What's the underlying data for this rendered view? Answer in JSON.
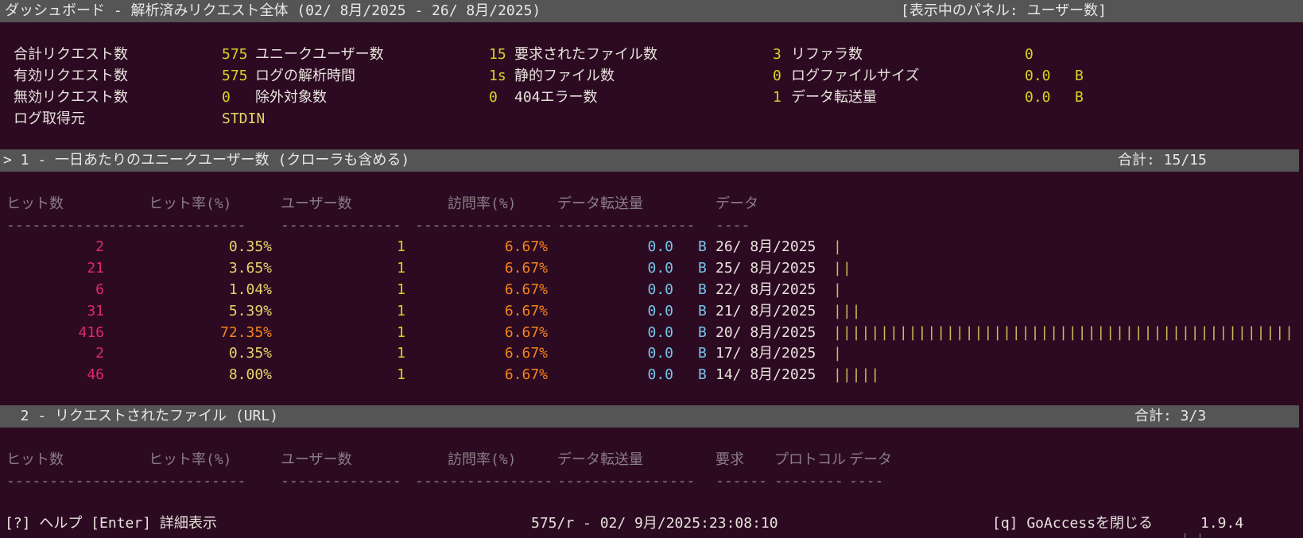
{
  "header": {
    "title": "ダッシュボード - 解析済みリクエスト全体 (02/ 8月/2025 - 26/ 8月/2025)",
    "active_panel": "[表示中のパネル: ユーザー数]"
  },
  "overall": {
    "col1": [
      {
        "label": "合計リクエスト数",
        "value": "575"
      },
      {
        "label": "有効リクエスト数",
        "value": "575"
      },
      {
        "label": "無効リクエスト数",
        "value": "0"
      },
      {
        "label": "ログ取得元",
        "value": "STDIN"
      }
    ],
    "col2": [
      {
        "label": "ユニークユーザー数",
        "value": "15"
      },
      {
        "label": "ログの解析時間",
        "value": "1s"
      },
      {
        "label": "除外対象数",
        "value": "0"
      }
    ],
    "col3": [
      {
        "label": "要求されたファイル数",
        "value": "3"
      },
      {
        "label": "静的ファイル数",
        "value": "0"
      },
      {
        "label": "404エラー数",
        "value": "1"
      }
    ],
    "col4": [
      {
        "label": "リファラ数",
        "value": "0",
        "unit": ""
      },
      {
        "label": "ログファイルサイズ",
        "value": "0.0",
        "unit": "B"
      },
      {
        "label": "データ転送量",
        "value": "0.0",
        "unit": "B"
      }
    ]
  },
  "panel1": {
    "title": "> 1 - 一日あたりのユニークユーザー数 (クローラも含める)",
    "total": "合計: 15/15",
    "columns": [
      "ヒット数",
      "ヒット率(%)",
      "ユーザー数",
      "訪問率(%)",
      "データ転送量",
      "データ"
    ],
    "dashes": [
      "------------",
      "----------------",
      "--------------",
      "----------------",
      "----------------",
      "----"
    ],
    "rows": [
      {
        "hits": "2",
        "hit_pct": "0.35%",
        "visitors": "1",
        "visit_pct": "6.67%",
        "bw": "0.0",
        "unit": "B",
        "date": "26/ 8月/2025",
        "graph": "|"
      },
      {
        "hits": "21",
        "hit_pct": "3.65%",
        "visitors": "1",
        "visit_pct": "6.67%",
        "bw": "0.0",
        "unit": "B",
        "date": "25/ 8月/2025",
        "graph": "||"
      },
      {
        "hits": "6",
        "hit_pct": "1.04%",
        "visitors": "1",
        "visit_pct": "6.67%",
        "bw": "0.0",
        "unit": "B",
        "date": "22/ 8月/2025",
        "graph": "|"
      },
      {
        "hits": "31",
        "hit_pct": "5.39%",
        "visitors": "1",
        "visit_pct": "6.67%",
        "bw": "0.0",
        "unit": "B",
        "date": "21/ 8月/2025",
        "graph": "|||"
      },
      {
        "hits": "416",
        "hit_pct": "72.35%",
        "visitors": "1",
        "visit_pct": "6.67%",
        "bw": "0.0",
        "unit": "B",
        "date": "20/ 8月/2025",
        "graph": "||||||||||||||||||||||||||||||||||||||||||||||||||||"
      },
      {
        "hits": "2",
        "hit_pct": "0.35%",
        "visitors": "1",
        "visit_pct": "6.67%",
        "bw": "0.0",
        "unit": "B",
        "date": "17/ 8月/2025",
        "graph": "|"
      },
      {
        "hits": "46",
        "hit_pct": "8.00%",
        "visitors": "1",
        "visit_pct": "6.67%",
        "bw": "0.0",
        "unit": "B",
        "date": "14/ 8月/2025",
        "graph": "|||||"
      }
    ]
  },
  "panel2": {
    "title": "  2 - リクエストされたファイル (URL)",
    "total": "合計: 3/3",
    "columns": [
      "ヒット数",
      "ヒット率(%)",
      "ユーザー数",
      "訪問率(%)",
      "データ転送量",
      "要求",
      "プロトコル",
      "データ"
    ],
    "dashes": [
      "------------",
      "----------------",
      "--------------",
      "----------------",
      "----------------",
      "------",
      "--------",
      "----"
    ]
  },
  "footer": {
    "left": "[?] ヘルプ [Enter] 詳細表示",
    "center": "575/r - 02/ 9月/2025:23:08:10",
    "quit": "[q] GoAccessを閉じる",
    "version": "1.9.4"
  },
  "colors": {
    "background": "#2c0b22",
    "bar": "#555555",
    "hits": "#e2266f",
    "hit_pct": "#e6d36a",
    "hit_pct_high": "#f2831e",
    "visitors": "#d8d323",
    "visit_pct": "#f2831e",
    "bandwidth": "#76c4e8",
    "overall_value": "#d8d323"
  }
}
